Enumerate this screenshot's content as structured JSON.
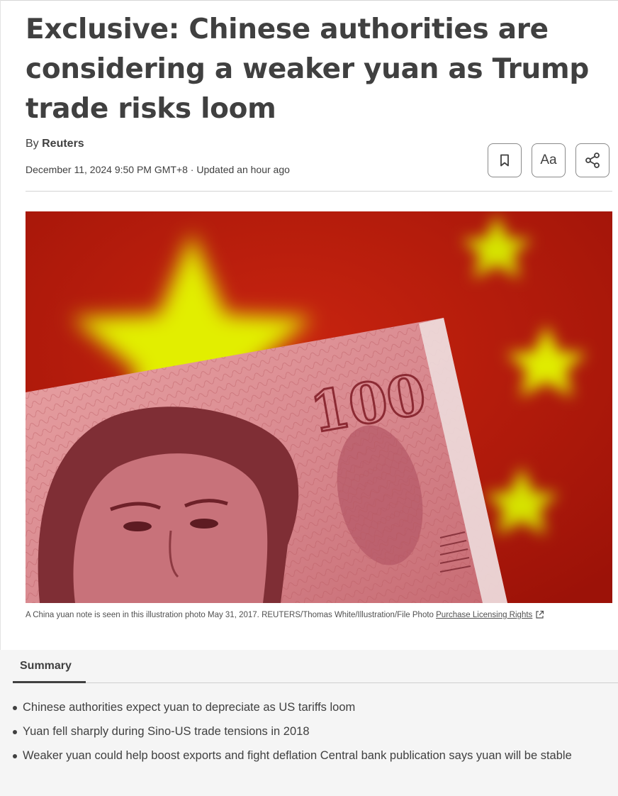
{
  "article": {
    "headline": "Exclusive: Chinese authorities are considering a weaker yuan as Trump trade risks loom",
    "byline_prefix": "By",
    "author": "Reuters",
    "dateline": "December 11, 2024 9:50 PM GMT+8 · Updated an hour ago"
  },
  "toolbar": {
    "bookmark_icon": "bookmark-icon",
    "text_size_label": "Aa",
    "share_icon": "share-icon"
  },
  "photo": {
    "note_number": "100",
    "caption_text": "A China yuan note is seen in this illustration photo May 31, 2017. REUTERS/Thomas White/Illustration/File Photo ",
    "license_link": "Purchase Licensing Rights"
  },
  "summary": {
    "tab_label": "Summary",
    "items": [
      "Chinese authorities expect yuan to depreciate as US tariffs loom",
      "Yuan fell sharply during Sino-US trade tensions in 2018",
      "Weaker yuan could help boost exports and fight deflation Central bank publication says yuan will be stable"
    ]
  },
  "colors": {
    "text": "#404040",
    "flag_red": "#b51a12",
    "star_yellow": "#e8f200",
    "note_pink": "#d98a90"
  }
}
